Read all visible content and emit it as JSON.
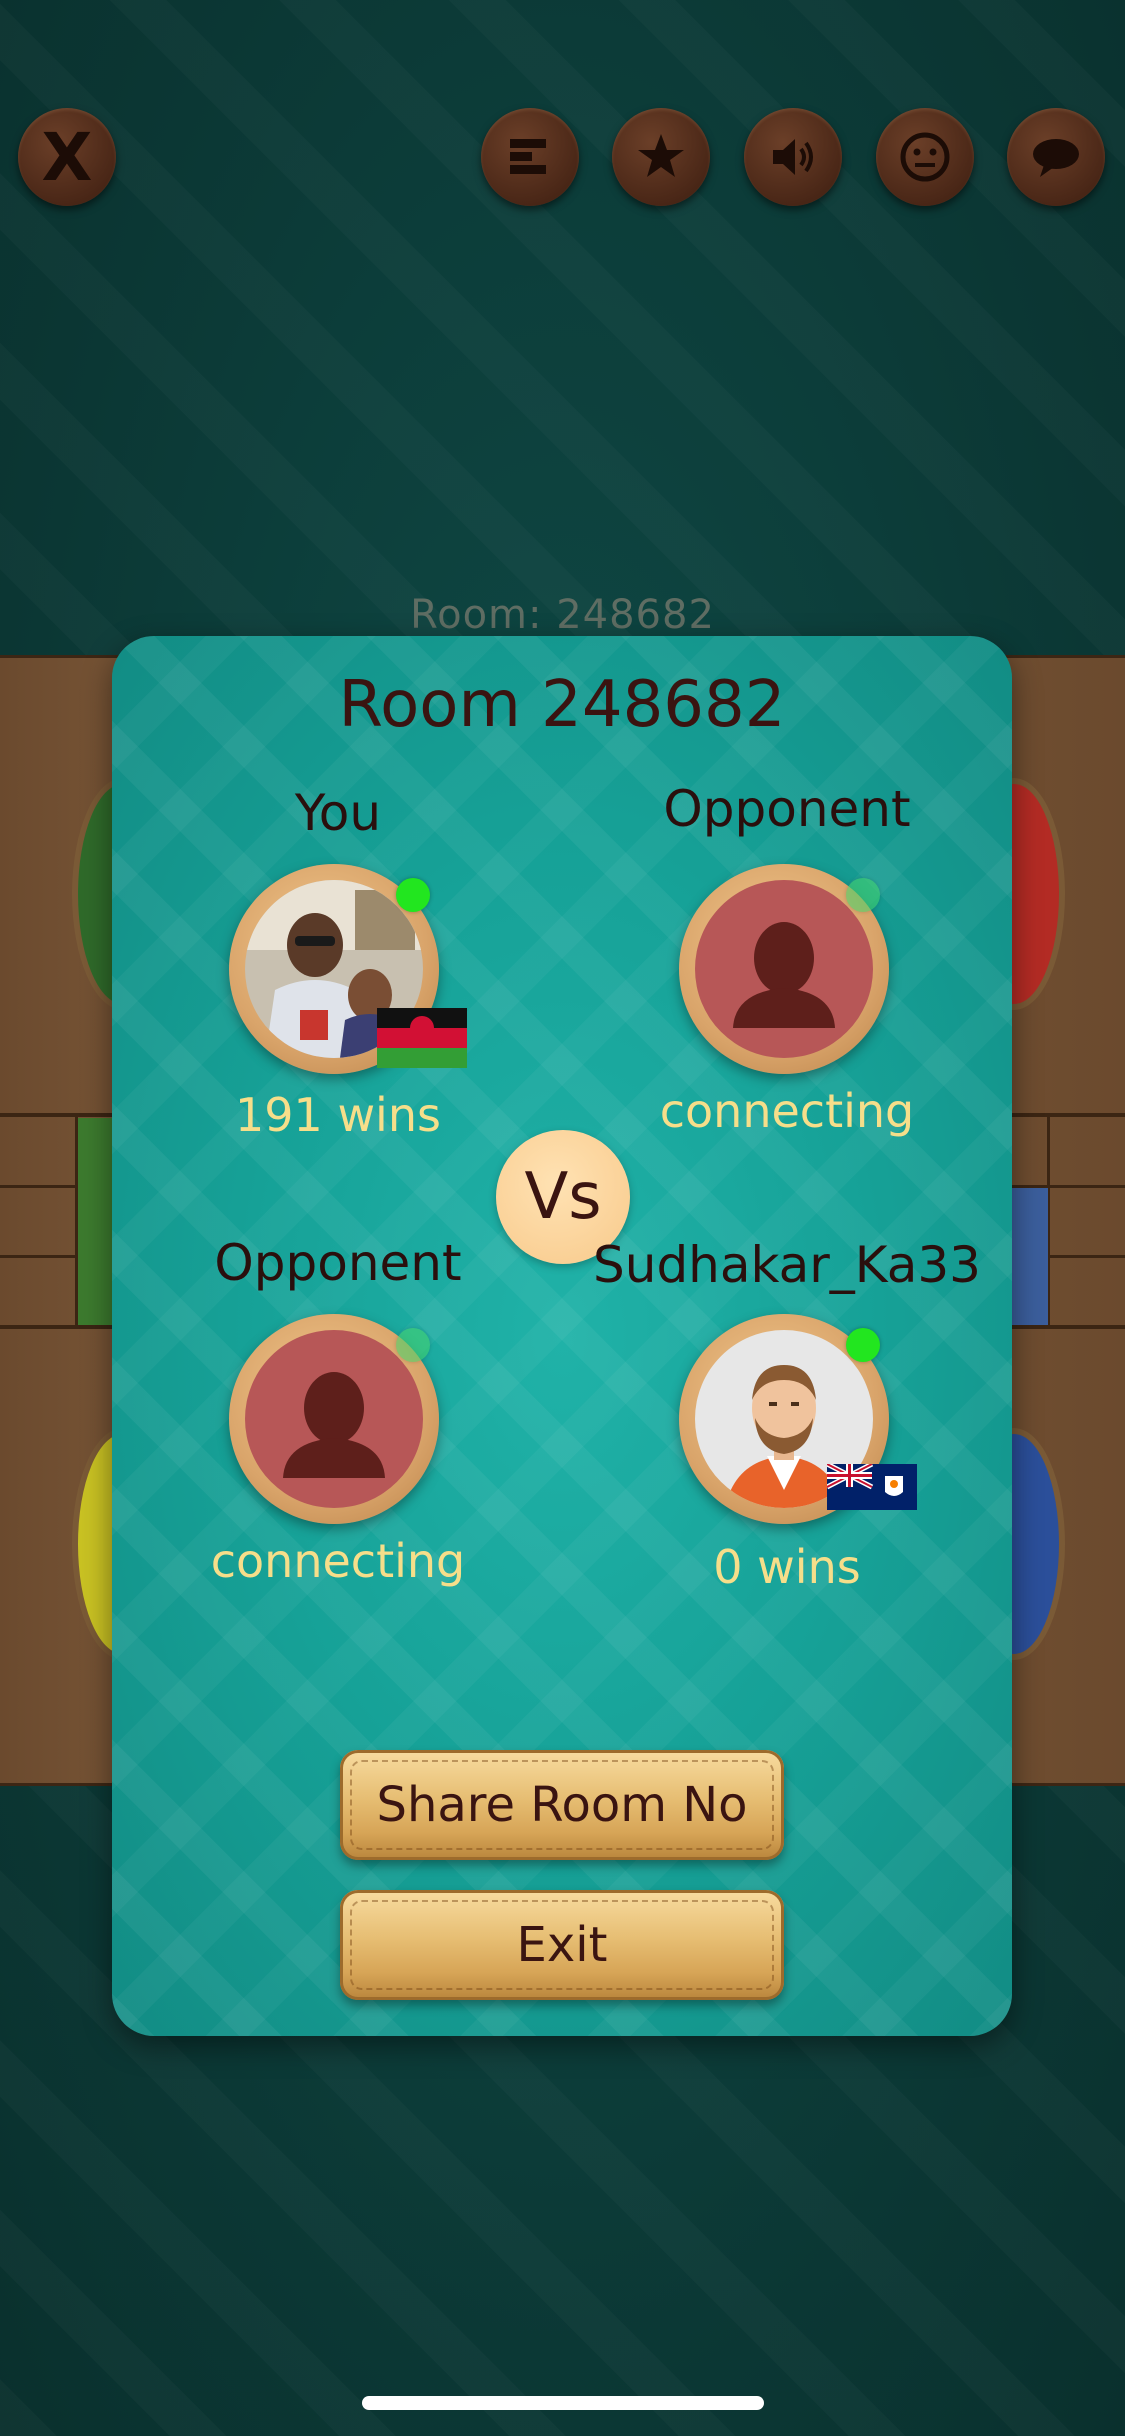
{
  "toolbar": {
    "close_label": "X",
    "icons": [
      "close-icon",
      "leaderboard-icon",
      "star-icon",
      "speaker-icon",
      "emoji-icon",
      "chat-icon"
    ]
  },
  "board": {
    "room_label": "Room: 248682"
  },
  "dialog": {
    "title": "Room 248682",
    "vs_label": "Vs",
    "players": [
      {
        "label": "You",
        "sub": "191 wins",
        "avatar": "user-photo",
        "flag": "malawi-flag",
        "online": true
      },
      {
        "label": "Opponent",
        "sub": "connecting",
        "avatar": "placeholder-silhouette",
        "online": false
      },
      {
        "label": "Opponent",
        "sub": "connecting",
        "avatar": "placeholder-silhouette",
        "online": false
      },
      {
        "label": "Sudhakar_Ka33",
        "sub": "0 wins",
        "avatar": "cartoon-man",
        "flag": "anguilla-flag",
        "online": true
      }
    ],
    "share_button": "Share Room No",
    "exit_button": "Exit"
  },
  "colors": {
    "background": "#0d3f3c",
    "dialog": "#16a197",
    "accent_gold": "#e6bd72",
    "text_dark": "#3a1411",
    "text_yellow": "#f6de8a",
    "online": "#22e61f"
  }
}
